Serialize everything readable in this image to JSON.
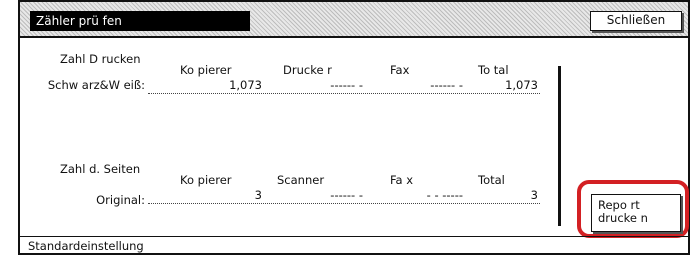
{
  "window": {
    "title": "Zähler prü fen",
    "close_label": "Schließen"
  },
  "drucken_section": {
    "heading": "Zahl D rucken",
    "columns": [
      "Ko pierer",
      "Drucke r",
      "Fax",
      "To tal"
    ],
    "row_label": "Schw arz&W eiß:",
    "values": [
      "1,073",
      "------ -",
      "------ -",
      "1,073"
    ]
  },
  "seiten_section": {
    "heading": "Zahl d. Seiten",
    "columns": [
      "Ko pierer",
      "Scanner",
      "Fa x",
      "Total"
    ],
    "row_label": "Original:",
    "values": [
      "3",
      "------ -",
      "- - -----",
      "3"
    ]
  },
  "report_button_label_line1": "Repo rt",
  "report_button_label_line2": "drucke n",
  "status_text": "Standardeinstellung"
}
